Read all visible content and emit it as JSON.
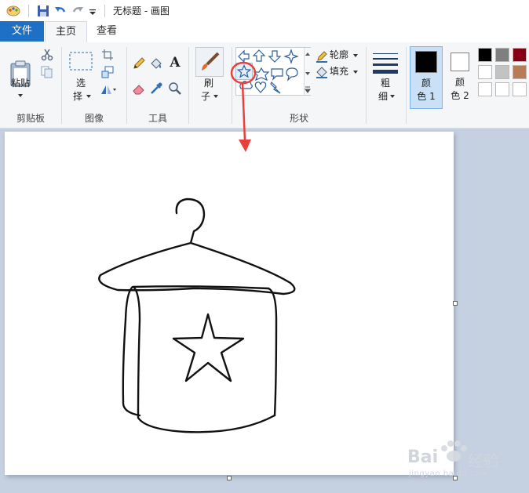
{
  "window": {
    "title": "无标题 - 画图"
  },
  "tabs": [
    {
      "label": "文件"
    },
    {
      "label": "主页"
    },
    {
      "label": "查看"
    }
  ],
  "ribbon": {
    "clipboard": {
      "paste_label": "粘贴",
      "group_label": "剪贴板"
    },
    "image": {
      "select_label_1": "选",
      "select_label_2": "择",
      "group_label": "图像"
    },
    "tools": {
      "group_label": "工具",
      "text_tool_glyph": "A"
    },
    "brushes": {
      "label_1": "刷",
      "label_2": "子"
    },
    "shapes": {
      "outline_label": "轮廓",
      "fill_label": "填充",
      "group_label": "形状"
    },
    "size": {
      "label_1": "粗",
      "label_2": "细"
    },
    "color1": {
      "label_1": "颜",
      "label_2": "色 1",
      "value": "#000000"
    },
    "color2": {
      "label_1": "颜",
      "label_2": "色 2",
      "value": "#ffffff"
    },
    "palette": [
      "#000000",
      "#7f7f7f",
      "#880015",
      "#ffffff",
      "#c3c3c3",
      "#b97a57",
      "#ffffff",
      "#ffffff",
      "#ffffff"
    ]
  },
  "annotation": {
    "color": "#e8413c"
  },
  "watermark": {
    "brand": "Bai",
    "brand2": "经验",
    "url": "jingyan.baidu.com"
  }
}
